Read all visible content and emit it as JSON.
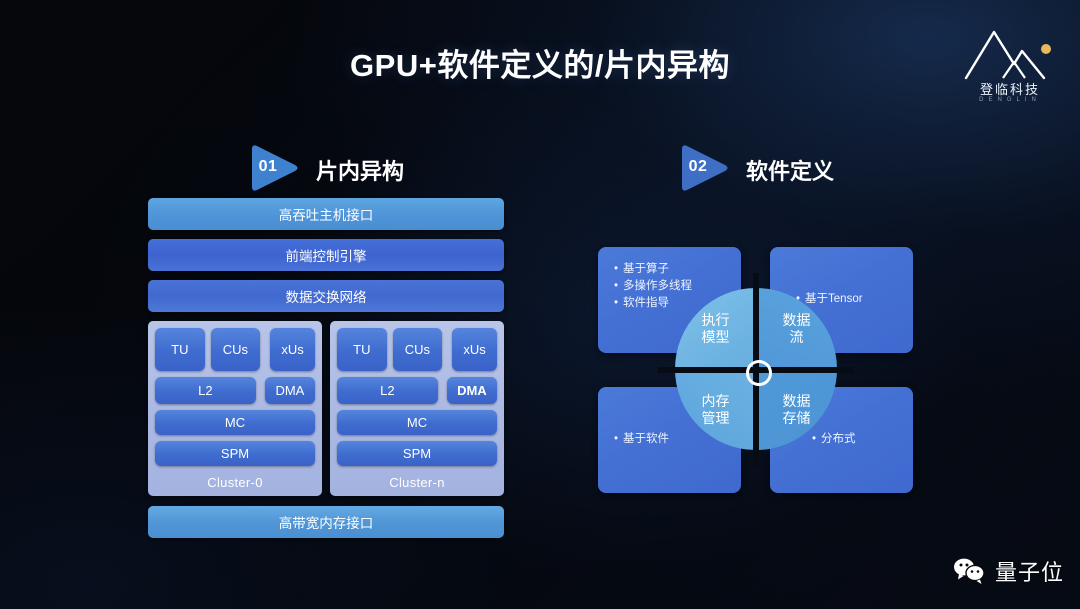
{
  "slide": {
    "title": "GPU+软件定义的/片内异构"
  },
  "brand": {
    "name": "登临科技",
    "subtitle": "DENGLIN",
    "logo_icon": "mountain-logo-icon"
  },
  "sections": [
    {
      "number": "01",
      "title": "片内异构"
    },
    {
      "number": "02",
      "title": "软件定义"
    }
  ],
  "architecture": {
    "top_bars": [
      "高吞吐主机接口",
      "前端控制引擎",
      "数据交换网络"
    ],
    "bottom_bar": "高带宽内存接口",
    "clusters": [
      {
        "label": "Cluster-0",
        "row1": [
          "TU",
          "CUs",
          "xUs"
        ],
        "row2": [
          "L2",
          "DMA"
        ],
        "row3": "MC",
        "row4": "SPM",
        "dma_highlight": false
      },
      {
        "label": "Cluster-n",
        "row1": [
          "TU",
          "CUs",
          "xUs"
        ],
        "row2": [
          "L2",
          "DMA"
        ],
        "row3": "MC",
        "row4": "SPM",
        "dma_highlight": true
      }
    ]
  },
  "quadrants": {
    "panels": {
      "top_left": {
        "items": [
          "基于算子",
          "多操作多线程",
          "软件指导"
        ]
      },
      "top_right": {
        "items": [
          "基于Tensor"
        ]
      },
      "bottom_left": {
        "items": [
          "基于软件"
        ]
      },
      "bottom_right": {
        "items": [
          "分布式"
        ]
      }
    },
    "circle": {
      "top_left": {
        "line1": "执行",
        "line2": "模型"
      },
      "top_right": {
        "line1": "数据",
        "line2": "流"
      },
      "bottom_left": {
        "line1": "内存",
        "line2": "管理"
      },
      "bottom_right": {
        "line1": "数据",
        "line2": "存储"
      }
    }
  },
  "watermark": {
    "icon": "wechat-icon",
    "text": "量子位"
  },
  "colors": {
    "background": "#04060b",
    "accent_blue": "#4a8ed2",
    "panel_blue": "#4470d4",
    "cluster_bg": "#aab8e2",
    "circle_light": "#6cb2e2",
    "text": "#ffffff"
  }
}
